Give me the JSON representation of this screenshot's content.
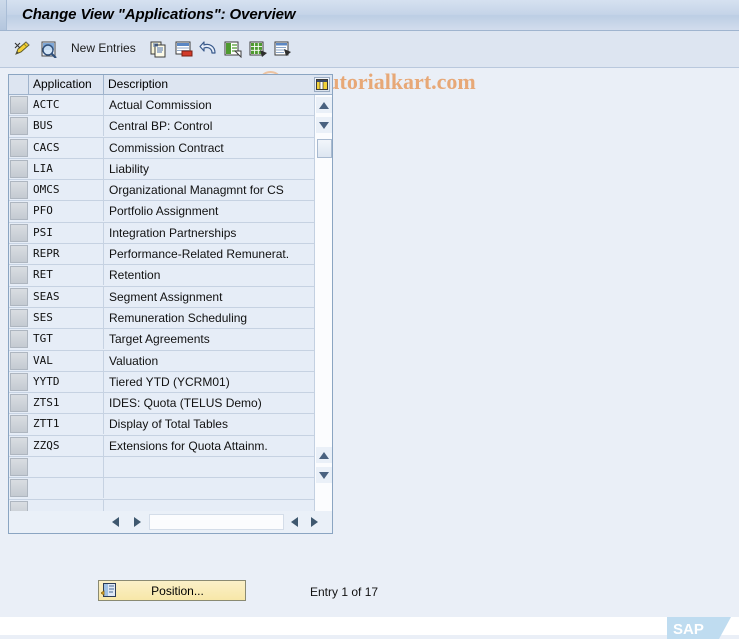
{
  "window": {
    "title": "Change View \"Applications\": Overview"
  },
  "watermark": {
    "text": "www.tutorialkart.com",
    "logo": "SAP"
  },
  "toolbar": {
    "items": [
      {
        "name": "change-display-icon",
        "label": "",
        "icon": "pencil-glasses-icon"
      },
      {
        "name": "display-details-icon",
        "label": "",
        "icon": "magnifier-icon"
      },
      {
        "name": "new-entries-button",
        "label": "New Entries",
        "icon": ""
      },
      {
        "name": "copy-as-icon",
        "label": "",
        "icon": "copy-icon"
      },
      {
        "name": "delete-icon",
        "label": "",
        "icon": "delete-row-icon"
      },
      {
        "name": "undo-icon",
        "label": "",
        "icon": "undo-arrow-icon"
      },
      {
        "name": "select-all-icon",
        "label": "",
        "icon": "table-select-icon"
      },
      {
        "name": "select-block-icon",
        "label": "",
        "icon": "table-block-icon"
      },
      {
        "name": "details-icon",
        "label": "",
        "icon": "table-details-icon"
      }
    ],
    "new_entries_label": "New Entries"
  },
  "table": {
    "columns": [
      {
        "key": "select",
        "label": ""
      },
      {
        "key": "application",
        "label": "Application"
      },
      {
        "key": "description",
        "label": "Description"
      }
    ],
    "config_icon": "grid-columns-icon",
    "rows": [
      {
        "application": "ACTC",
        "description": "Actual Commission"
      },
      {
        "application": "BUS",
        "description": "Central BP: Control"
      },
      {
        "application": "CACS",
        "description": "Commission Contract"
      },
      {
        "application": "LIA",
        "description": "Liability"
      },
      {
        "application": "OMCS",
        "description": "Organizational Managmnt for CS"
      },
      {
        "application": "PFO",
        "description": "Portfolio Assignment"
      },
      {
        "application": "PSI",
        "description": "Integration Partnerships"
      },
      {
        "application": "REPR",
        "description": "Performance-Related Remunerat."
      },
      {
        "application": "RET",
        "description": "Retention"
      },
      {
        "application": "SEAS",
        "description": "Segment Assignment"
      },
      {
        "application": "SES",
        "description": "Remuneration Scheduling"
      },
      {
        "application": "TGT",
        "description": "Target Agreements"
      },
      {
        "application": "VAL",
        "description": "Valuation"
      },
      {
        "application": "YYTD",
        "description": "Tiered YTD (YCRM01)"
      },
      {
        "application": "ZTS1",
        "description": "IDES: Quota (TELUS Demo)"
      },
      {
        "application": "ZTT1",
        "description": "Display of Total Tables"
      },
      {
        "application": "ZZQS",
        "description": "Extensions for Quota Attainm."
      },
      {
        "application": "",
        "description": ""
      },
      {
        "application": "",
        "description": ""
      },
      {
        "application": "",
        "description": ""
      }
    ]
  },
  "footer": {
    "position_label": "Position...",
    "position_icon": "position-jump-icon",
    "entry_status": "Entry 1 of 17"
  },
  "colors": {
    "window_background": "#eaeff7",
    "title_bar": "#c5d4e8",
    "toolbar": "#dde5f1",
    "table_row": "#e6edf7",
    "table_border": "#8ba5c2",
    "button_yellow": "#f7e7a8",
    "watermark_orange": "#e7a877"
  }
}
